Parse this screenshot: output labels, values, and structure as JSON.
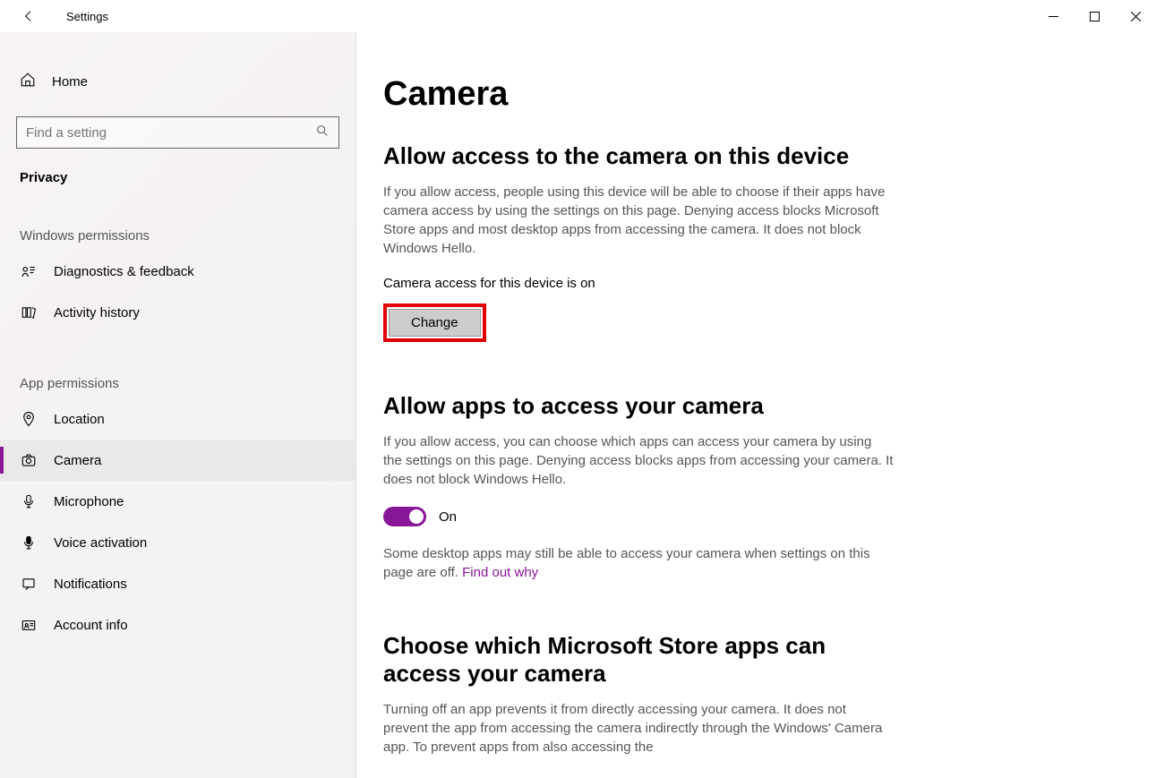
{
  "titlebar": {
    "title": "Settings"
  },
  "sidebar": {
    "home": "Home",
    "search_placeholder": "Find a setting",
    "category": "Privacy",
    "section1": "Windows permissions",
    "items1": [
      {
        "label": "Diagnostics & feedback",
        "id": "diagnostics"
      },
      {
        "label": "Activity history",
        "id": "activity-history"
      }
    ],
    "section2": "App permissions",
    "items2": [
      {
        "label": "Location",
        "id": "location"
      },
      {
        "label": "Camera",
        "id": "camera",
        "active": true
      },
      {
        "label": "Microphone",
        "id": "microphone"
      },
      {
        "label": "Voice activation",
        "id": "voice-activation"
      },
      {
        "label": "Notifications",
        "id": "notifications"
      },
      {
        "label": "Account info",
        "id": "account-info"
      }
    ]
  },
  "main": {
    "h1": "Camera",
    "sec1": {
      "h2": "Allow access to the camera on this device",
      "desc": "If you allow access, people using this device will be able to choose if their apps have camera access by using the settings on this page. Denying access blocks Microsoft Store apps and most desktop apps from accessing the camera. It does not block Windows Hello.",
      "status": "Camera access for this device is on",
      "change": "Change"
    },
    "sec2": {
      "h2": "Allow apps to access your camera",
      "desc": "If you allow access, you can choose which apps can access your camera by using the settings on this page. Denying access blocks apps from accessing your camera. It does not block Windows Hello.",
      "toggle_label": "On",
      "note_pre": "Some desktop apps may still be able to access your camera when settings on this page are off. ",
      "note_link": "Find out why"
    },
    "sec3": {
      "h2": "Choose which Microsoft Store apps can access your camera",
      "desc": "Turning off an app prevents it from directly accessing your camera. It does not prevent the app from accessing the camera indirectly through the Windows' Camera app. To prevent apps from also accessing the"
    }
  }
}
